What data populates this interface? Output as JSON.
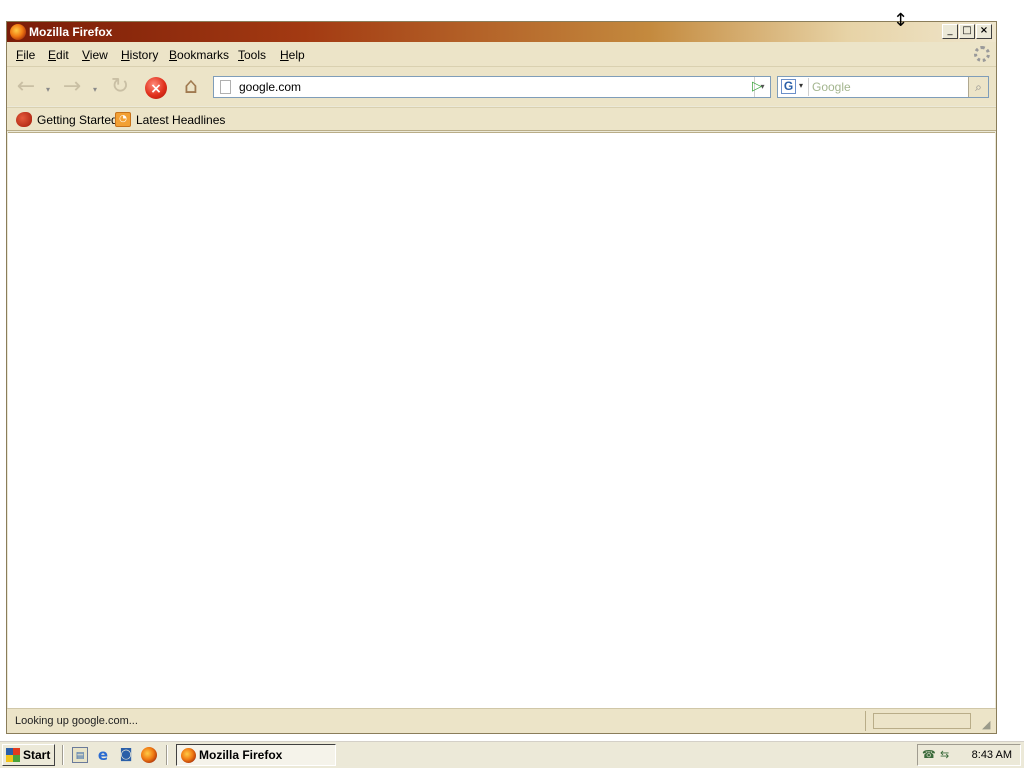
{
  "window": {
    "title": "Mozilla Firefox",
    "controls": {
      "minimize": "_",
      "maximize": "□",
      "close": "×"
    }
  },
  "menubar": {
    "items": [
      {
        "label": "File"
      },
      {
        "label": "Edit"
      },
      {
        "label": "View"
      },
      {
        "label": "History"
      },
      {
        "label": "Bookmarks"
      },
      {
        "label": "Tools"
      },
      {
        "label": "Help"
      }
    ]
  },
  "navbar": {
    "back_icon": "←",
    "forward_icon": "→",
    "dropdown_icon": "▾",
    "reload_icon": "↻",
    "stop_icon": "×",
    "home_icon": "⌂",
    "url": "google.com",
    "url_dropdown_icon": "▾",
    "go_icon": "▷",
    "search_engine_letter": "G",
    "search_placeholder": "Google",
    "search_go_icon": "⌕"
  },
  "bookmarks": {
    "items": [
      {
        "label": "Getting Started",
        "icon": "getting-started-icon"
      },
      {
        "label": "Latest Headlines",
        "icon": "rss-icon",
        "glyph": "◔"
      }
    ]
  },
  "statusbar": {
    "text": "Looking up google.com...",
    "grip": "◢"
  },
  "taskbar": {
    "start_label": "Start",
    "task_label": "Mozilla Firefox",
    "ql_desktop_glyph": "▤",
    "ql_ie_glyph": "e",
    "ql_media_glyph": "◙",
    "tray_glyph_1": "☎",
    "tray_glyph_2": "⇆",
    "clock": "8:43 AM"
  },
  "cursor": {
    "glyph": "↕"
  },
  "colors": {
    "titlebar_start": "#7a1c08",
    "titlebar_end": "#efe6cd",
    "chrome_bg": "#ece4c8",
    "taskbar_bg": "#ece9d8"
  }
}
